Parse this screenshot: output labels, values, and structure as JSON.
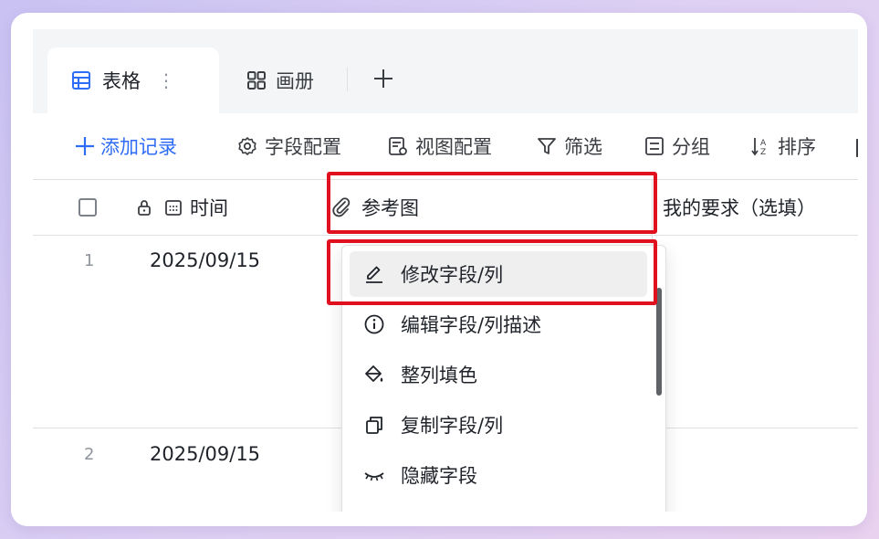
{
  "tabs": {
    "active": {
      "label": "表格",
      "more": "⋮"
    },
    "gallery": {
      "label": "画册"
    },
    "add": "+"
  },
  "toolbar": {
    "add_record": "添加记录",
    "field_config": "字段配置",
    "view_config": "视图配置",
    "filter": "筛选",
    "group": "分组",
    "sort": "排序"
  },
  "columns": {
    "time": "时间",
    "reference": "参考图",
    "requirement": "我的要求（选填）"
  },
  "rows": [
    {
      "num": "1",
      "time": "2025/09/15"
    },
    {
      "num": "2",
      "time": "2025/09/15"
    }
  ],
  "menu": {
    "items": [
      {
        "label": "修改字段/列",
        "icon": "pencil-icon"
      },
      {
        "label": "编辑字段/列描述",
        "icon": "info-icon"
      },
      {
        "label": "整列填色",
        "icon": "paint-bucket-icon"
      },
      {
        "label": "复制字段/列",
        "icon": "copy-icon"
      },
      {
        "label": "隐藏字段",
        "icon": "eye-closed-icon"
      }
    ]
  },
  "colors": {
    "accent": "#2f6df6",
    "highlight": "#e0101e",
    "text": "#1f2329",
    "border": "#dee0e3"
  }
}
